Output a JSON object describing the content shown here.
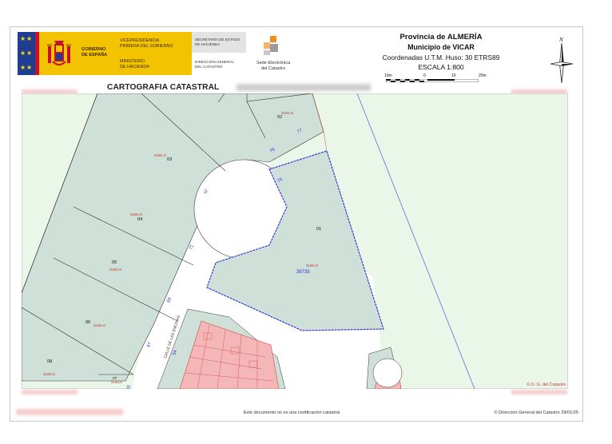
{
  "header": {
    "gobierno": [
      "GOBIERNO",
      "DE ESPAÑA"
    ],
    "vicepresidencia": [
      "VICEPRESIDENCIA",
      "PRIMERA DEL GOBIERNO"
    ],
    "ministerio": [
      "MINISTERIO",
      "DE HACIENDA"
    ],
    "secretaria": [
      "SECRETARÍA DE ESTADO",
      "DE HACIENDA"
    ],
    "direccion": [
      "DIRECCIÓN GENERAL",
      "DEL CATASTRO"
    ],
    "sede": [
      "Sede Electrónica",
      "del Catastro"
    ],
    "provincia": "Provincia de ALMERÍA",
    "municipio": "Municipio de VICAR",
    "coordenadas": "Coordenadas U.T.M. Huso: 30 ETRS89",
    "escala": "ESCALA 1:800",
    "scale_ticks": [
      "10m",
      "0",
      "10",
      "20m"
    ],
    "north": "N",
    "cartografia": "CARTOGRAFIA CATASTRAL"
  },
  "map": {
    "parcel_labels": [
      {
        "num": "02",
        "tag": "SUELO"
      },
      {
        "num": "03",
        "tag": "SUELO"
      },
      {
        "num": "04",
        "tag": "SUELO"
      },
      {
        "num": "05",
        "tag": "SUELO"
      },
      {
        "num": "06",
        "tag": "SUELO"
      },
      {
        "num": "08",
        "tag": "SUELO"
      },
      {
        "num": "07",
        "tag": "SUELO"
      },
      {
        "num": "01",
        "tag": "SUELO"
      }
    ],
    "parcel_ref": "39735",
    "street_numbers": [
      "77",
      "76",
      "75",
      "73",
      "71",
      "69",
      "67",
      "54",
      "53"
    ],
    "street_name": "CALLE DE LAS ENCINAS",
    "copyright": "© D. G. del Catastro"
  },
  "footer": {
    "notice": "Este documento no es una certificación catastral",
    "copyright": "© Dirección General del Catastro 29/01/25"
  },
  "colors": {
    "parcel_fill": "#cfe0d8",
    "background_fill": "#e9f6e8",
    "road_fill": "#ffffff",
    "building_fill": "#f4b6b6",
    "selected_outline": "#2a2ad6",
    "boundary": "#333333"
  }
}
